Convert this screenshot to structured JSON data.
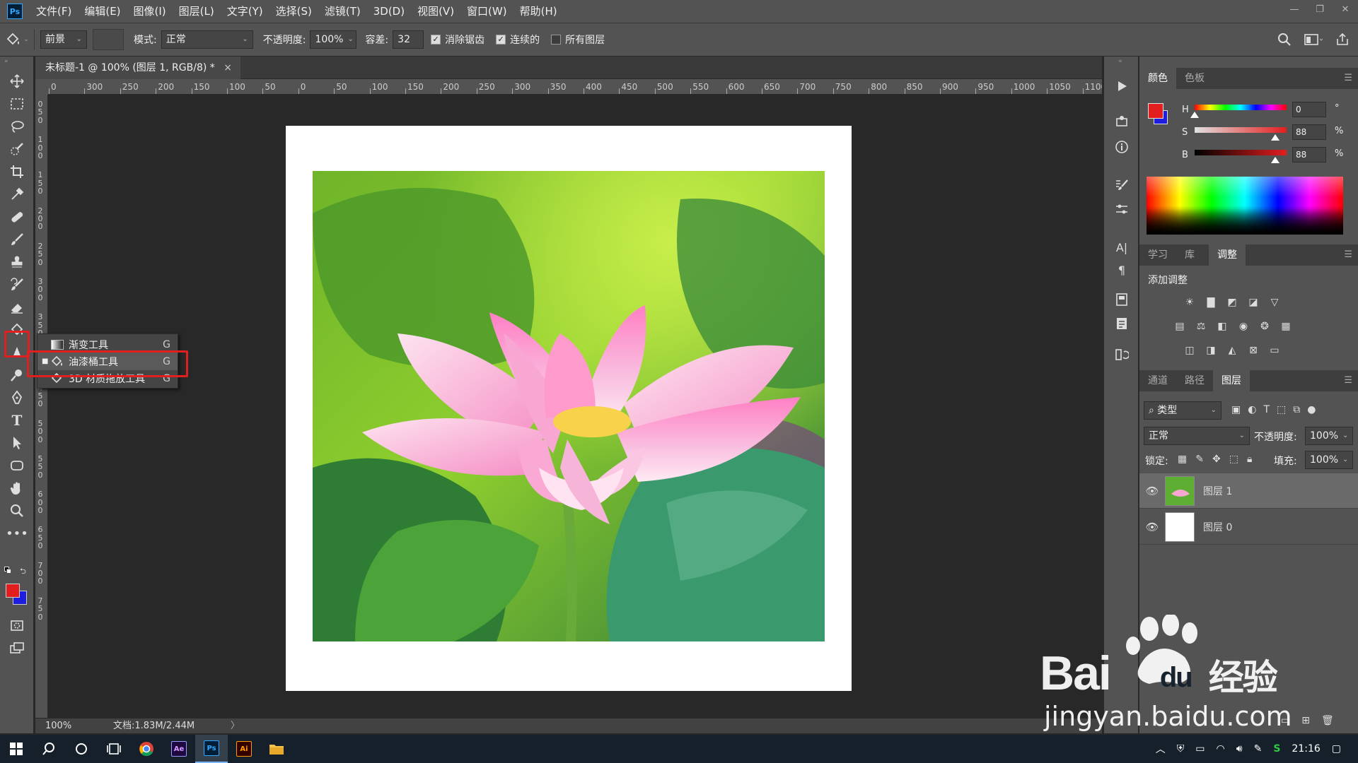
{
  "app": {
    "logo": "Ps"
  },
  "menu": [
    "文件(F)",
    "编辑(E)",
    "图像(I)",
    "图层(L)",
    "文字(Y)",
    "选择(S)",
    "滤镜(T)",
    "3D(D)",
    "视图(V)",
    "窗口(W)",
    "帮助(H)"
  ],
  "window_controls": [
    "—",
    "❐",
    "✕"
  ],
  "options": {
    "fill_source": "前景",
    "mode_label": "模式:",
    "mode_value": "正常",
    "opacity_label": "不透明度:",
    "opacity_value": "100%",
    "tolerance_label": "容差:",
    "tolerance_value": "32",
    "anti_alias_label": "消除锯齿",
    "anti_alias": true,
    "contiguous_label": "连续的",
    "contiguous": true,
    "all_layers_label": "所有图层",
    "all_layers": false
  },
  "document": {
    "tab_title": "未标题-1 @ 100% (图层 1, RGB/8) *",
    "close": "×",
    "zoom": "100%",
    "doc_size": "文档:1.83M/2.44M",
    "status_arrow": "〉"
  },
  "ruler_h": [
    "0",
    "300",
    "250",
    "200",
    "150",
    "100",
    "50",
    "0",
    "50",
    "100",
    "150",
    "200",
    "250",
    "300",
    "350",
    "400",
    "450",
    "500",
    "550",
    "600",
    "650",
    "700",
    "750",
    "800",
    "850",
    "900",
    "950",
    "1000",
    "1050",
    "1100"
  ],
  "ruler_v": [
    "0",
    "5",
    "0",
    "1",
    "0",
    "0",
    "1",
    "5",
    "0",
    "2",
    "0",
    "0",
    "2",
    "5",
    "0",
    "3",
    "0",
    "0",
    "3",
    "5",
    "0",
    "4",
    "0",
    "0",
    "4",
    "5",
    "0",
    "5",
    "0",
    "0",
    "5",
    "5",
    "0",
    "6",
    "0",
    "0",
    "6",
    "5",
    "0",
    "7",
    "0",
    "0",
    "7",
    "5",
    "0"
  ],
  "flyout": {
    "items": [
      {
        "label": "渐变工具",
        "key": "G",
        "active": false
      },
      {
        "label": "油漆桶工具",
        "key": "G",
        "active": true
      },
      {
        "label": "3D 材质拖放工具",
        "key": "G",
        "active": false
      }
    ]
  },
  "colors": {
    "foreground": "#e31e1e",
    "background": "#1e1ee0",
    "highlight": "#e02020"
  },
  "color_panel": {
    "tabs": [
      "颜色",
      "色板"
    ],
    "active_tab": 0,
    "h_label": "H",
    "h_value": "0",
    "h_unit": "°",
    "s_label": "S",
    "s_value": "88",
    "s_unit": "%",
    "b_label": "B",
    "b_value": "88",
    "b_unit": "%",
    "h_level": 0,
    "s_level": 0.88,
    "b_level": 0.88
  },
  "adjust_panel": {
    "tabs": [
      "学习",
      "库",
      "调整"
    ],
    "active_tab": 2,
    "title": "添加调整",
    "icons_row1": [
      "brightness-icon",
      "levels-icon",
      "curves-icon",
      "exposure-icon",
      "vibrance-icon"
    ],
    "icons_row2": [
      "hue-saturation-icon",
      "color-balance-icon",
      "black-white-icon",
      "photo-filter-icon",
      "channel-mixer-icon",
      "color-lookup-icon"
    ],
    "icons_row3": [
      "invert-icon",
      "posterize-icon",
      "threshold-icon",
      "selective-color-icon",
      "gradient-map-icon"
    ]
  },
  "layers_panel": {
    "tabs": [
      "通道",
      "路径",
      "图层"
    ],
    "active_tab": 2,
    "filter_label": "类型",
    "blend_mode": "正常",
    "opacity_label": "不透明度:",
    "opacity_value": "100%",
    "lock_label": "锁定:",
    "fill_label": "填充:",
    "fill_value": "100%",
    "layers": [
      {
        "name": "图层 1",
        "selected": true
      },
      {
        "name": "图层 0",
        "selected": false
      }
    ]
  },
  "taskbar": {
    "apps": [
      "Ae",
      "Ps",
      "Ai"
    ],
    "time": "21:16"
  },
  "watermark": {
    "brand": "Bai",
    "brand_du": "du",
    "brand_suffix": "经验",
    "url": "jingyan.baidu.com"
  }
}
